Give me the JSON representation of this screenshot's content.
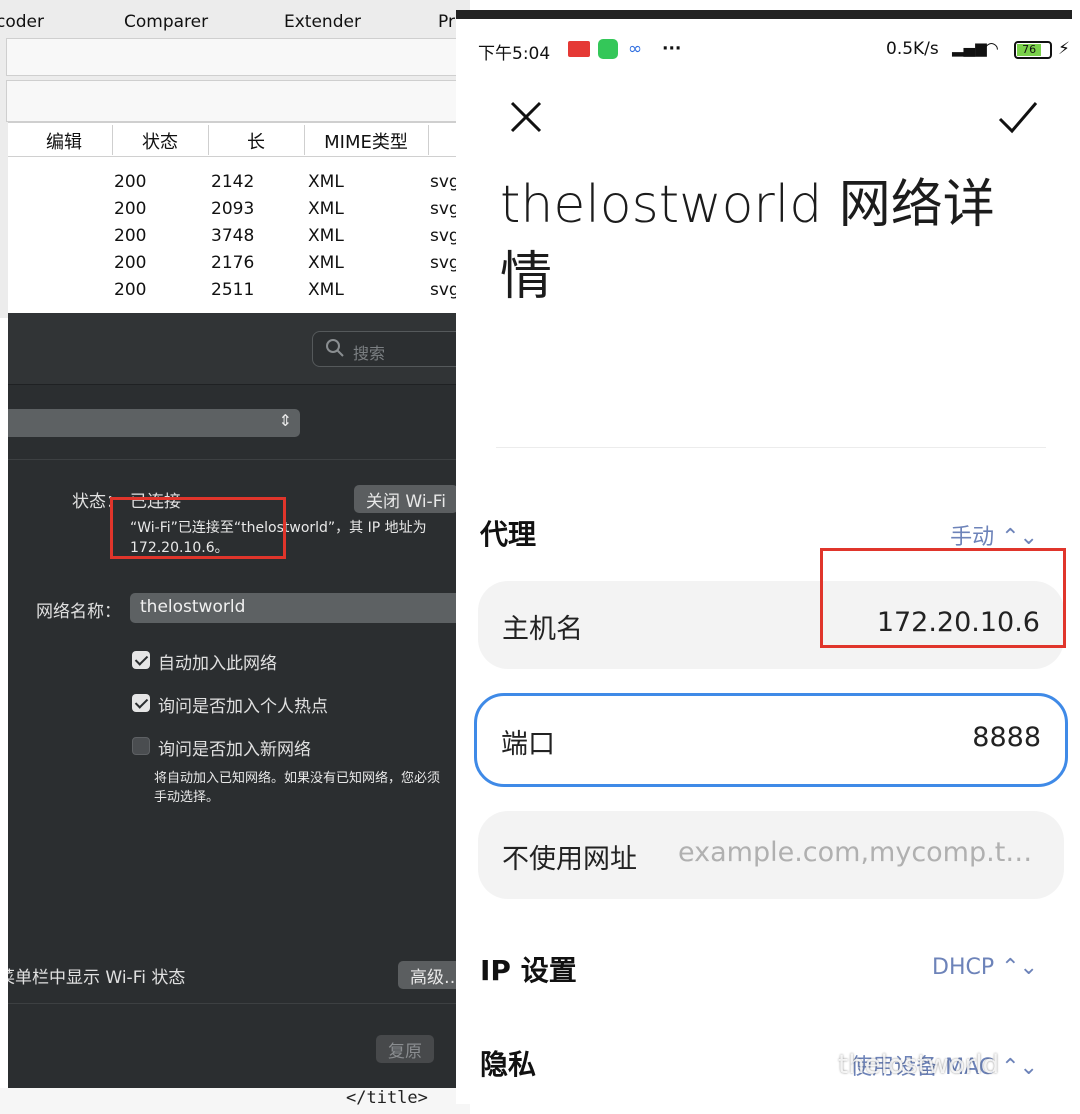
{
  "burp": {
    "tabs": [
      "coder",
      "Comparer",
      "Extender",
      "Pr"
    ],
    "columns": [
      "编辑",
      "状态",
      "长",
      "MIME类型"
    ],
    "rows": [
      {
        "status": "200",
        "length": "2142",
        "mime": "XML",
        "ext": "svg"
      },
      {
        "status": "200",
        "length": "2093",
        "mime": "XML",
        "ext": "svg"
      },
      {
        "status": "200",
        "length": "3748",
        "mime": "XML",
        "ext": "svg"
      },
      {
        "status": "200",
        "length": "2176",
        "mime": "XML",
        "ext": "svg"
      },
      {
        "status": "200",
        "length": "2511",
        "mime": "XML",
        "ext": "svg"
      }
    ]
  },
  "mac": {
    "search_placeholder": "搜索",
    "status_label": "状态：",
    "status_value": "已连接",
    "wifi_off_button": "关闭 Wi-Fi",
    "status_detail_1": "“Wi-Fi”已连接至“thelostworld”，其 IP 地址为",
    "status_detail_2": "172.20.10.6。",
    "network_name_label": "网络名称：",
    "network_name_value": "thelostworld",
    "checks": [
      {
        "label": "自动加入此网络",
        "checked": true
      },
      {
        "label": "询问是否加入个人热点",
        "checked": true
      },
      {
        "label": "询问是否加入新网络",
        "checked": false
      }
    ],
    "note_1": "将自动加入已知网络。如果没有已知网络，您必须",
    "note_2": "手动选择。",
    "menubar_label": "菜单栏中显示 Wi-Fi 状态",
    "advanced_button": "高级…",
    "revert_button": "复原"
  },
  "code_strip": {
    "text": "</title>"
  },
  "phone": {
    "status": {
      "time": "下午5:04",
      "speed": "0.5K/s",
      "battery": "76"
    },
    "title": "thelostworld 网络详情",
    "proxy": {
      "label": "代理",
      "value": "手动 ⌃⌄"
    },
    "hostname": {
      "label": "主机名",
      "value": "172.20.10.6"
    },
    "port": {
      "label": "端口",
      "value": "8888"
    },
    "bypass": {
      "label": "不使用网址",
      "placeholder": "example.com,mycomp.t…"
    },
    "ip_settings": {
      "label": "IP 设置",
      "value": "DHCP ⌃⌄"
    },
    "privacy": {
      "label": "隐私",
      "value": "使用设备 MAC ⌃⌄"
    }
  },
  "watermark": "thelostworld",
  "colors": {
    "highlight_red": "#e0352b",
    "focus_blue": "#3f8ae7",
    "mac_bg": "#2b2e30"
  }
}
